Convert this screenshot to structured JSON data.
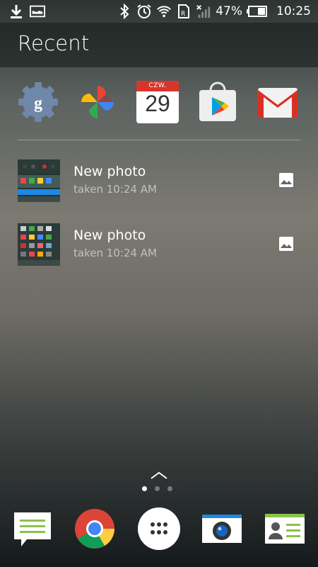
{
  "status_bar": {
    "battery_percent": "47%",
    "time": "10:25",
    "icons": [
      "download-icon",
      "image-notification-icon",
      "bluetooth-icon",
      "alarm-icon",
      "wifi-icon",
      "sim-icon",
      "no-signal-icon",
      "battery-icon"
    ]
  },
  "header": {
    "title": "Recent"
  },
  "recent_apps": [
    {
      "icon": "google-settings-icon"
    },
    {
      "icon": "google-photos-icon"
    },
    {
      "icon": "calendar-icon",
      "month": "CZW.",
      "day": "29"
    },
    {
      "icon": "play-store-icon"
    },
    {
      "icon": "gmail-icon"
    }
  ],
  "recent_items": [
    {
      "title": "New photo",
      "subtitle": "taken 10:24 AM",
      "action_icon": "image-icon"
    },
    {
      "title": "New photo",
      "subtitle": "taken 10:24 AM",
      "action_icon": "image-icon"
    }
  ],
  "pager": {
    "page_count": 3,
    "active_page": 1
  },
  "dock": [
    {
      "icon": "messages-icon"
    },
    {
      "icon": "chrome-icon"
    },
    {
      "icon": "app-drawer-icon"
    },
    {
      "icon": "camera-icon"
    },
    {
      "icon": "contacts-icon"
    }
  ],
  "colors": {
    "accent_red": "#d9342b",
    "google_blue": "#4285f4",
    "google_green": "#34a853",
    "google_yellow": "#fbbc05"
  }
}
